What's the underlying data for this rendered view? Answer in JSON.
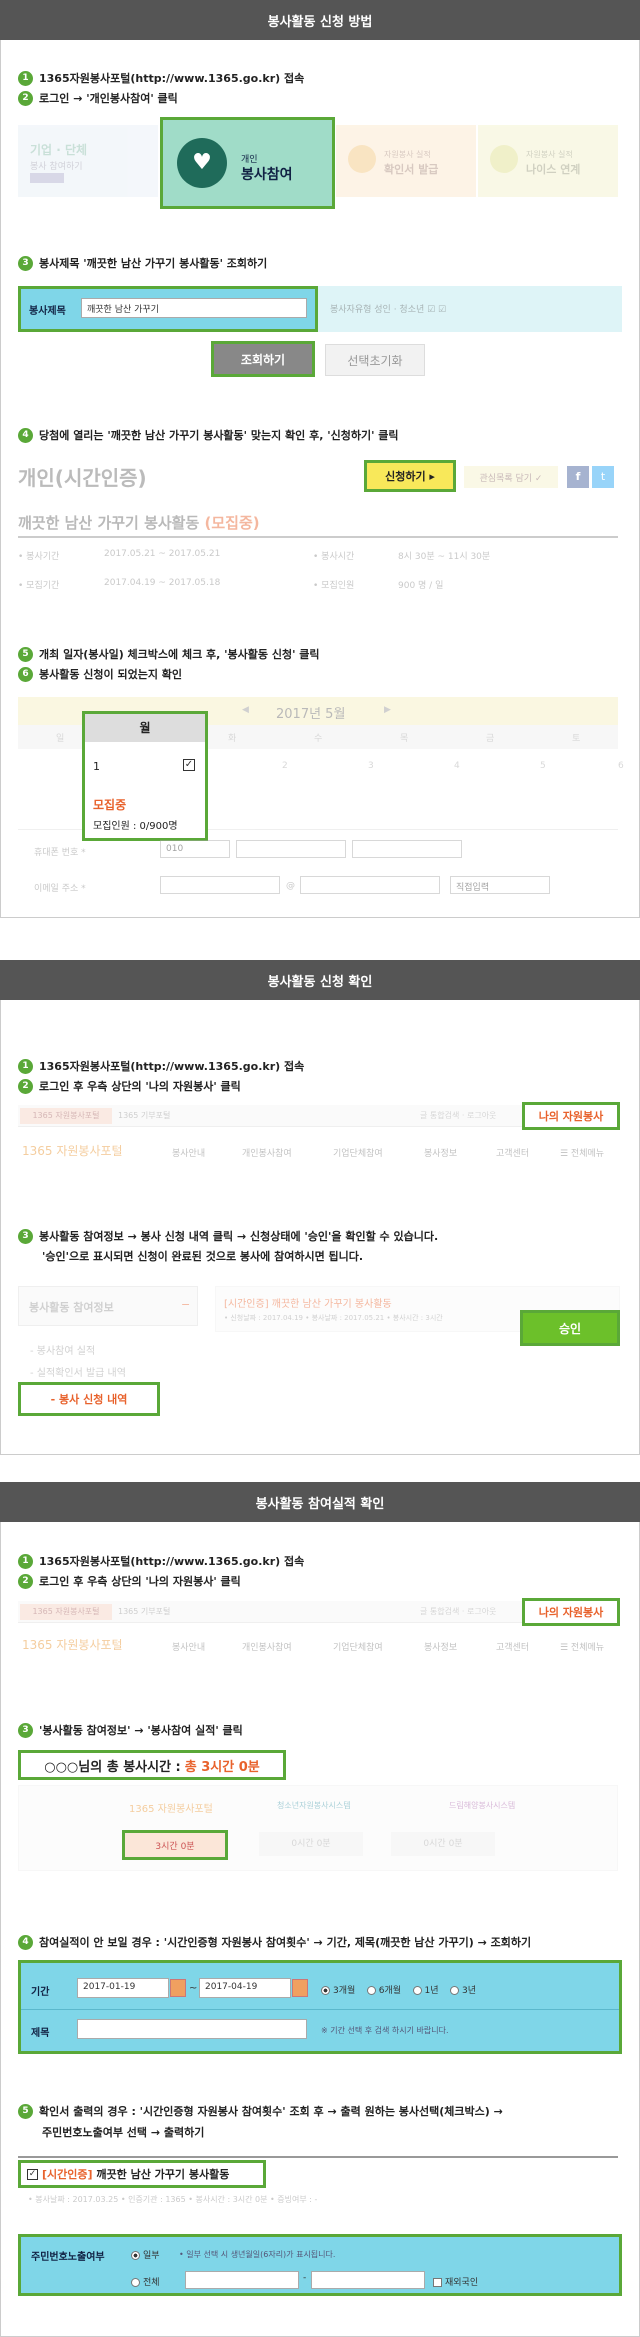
{
  "section1": {
    "title": "봉사활동 신청 방법",
    "step1": "1365자원봉사포털(http://www.1365.go.kr) 접속",
    "step2": "로그인 → '개인봉사참여' 클릭",
    "menu": {
      "group_label": "기업 · 단체",
      "group_sub": "봉사 참여하기",
      "personal_small": "개인",
      "personal_big": "봉사참여",
      "confirm_small": "자원봉사 실적",
      "confirm_big": "확인서 발급",
      "neis_small": "자원봉사 실적",
      "neis_big": "나이스 연계"
    },
    "step3": "봉사제목 '깨끗한 남산 가꾸기 봉사활동' 조회하기",
    "search_label": "봉사제목",
    "search_value": "깨끗한 남산 가꾸기",
    "search_type_label": "봉사자유형",
    "search_type_opts": "성인 · 청소년",
    "btn_search": "조회하기",
    "btn_reset": "선택초기화",
    "step4": "당첨에 열리는 '깨끗한 남산 가꾸기 봉사활동' 맞는지 확인 후, '신청하기' 클릭",
    "category": "개인(시간인증)",
    "btn_apply": "신청하기 ▸",
    "btn_interest": "관심목록 담기 ✓",
    "activity_title": "깨끗한 남산 가꾸기 봉사활동",
    "activity_status": "(모집중)",
    "info": {
      "l1": "봉사기간",
      "v1": "2017.05.21 ~ 2017.05.21",
      "l2": "봉사시간",
      "v2": "8시 30분 ~ 11시 30분",
      "l3": "모집기간",
      "v3": "2017.04.19 ~ 2017.05.18",
      "l4": "모집인원",
      "v4": "900 명 / 일"
    },
    "step5": "개최 일자(봉사일) 체크박스에 체크 후, '봉사활동 신청' 클릭",
    "step6": "봉사활동 신청이 되었는지 확인",
    "calendar": {
      "month": "2017년 5월",
      "days": [
        "일",
        "월",
        "화",
        "수",
        "목",
        "금",
        "토"
      ],
      "dates": [
        "1",
        "2",
        "3",
        "4",
        "5",
        "6"
      ],
      "mon_label": "월",
      "date_sel": "1",
      "recruiting": "모집중",
      "capacity": "모집인원 : 0/900명"
    },
    "form": {
      "phone": "휴대폰 번호 *",
      "phone_pre": "010",
      "email": "이메일 주소 *",
      "at": "@",
      "email_sel": "직접입력"
    }
  },
  "section2": {
    "title": "봉사활동 신청 확인",
    "step1": "1365자원봉사포털(http://www.1365.go.kr) 접속",
    "step2": "로그인 후 우측 상단의 '나의 자원봉사' 클릭",
    "topbar": {
      "left1": "1365 자원봉사포털",
      "left2": "1365 기부포털",
      "right": "나의 자원봉사",
      "extra": "글 통합검색 · 로그아웃"
    },
    "logo": "1365 자원봉사포털",
    "nav": [
      "봉사안내",
      "개인봉사참여",
      "기업단체참여",
      "봉사정보",
      "고객센터",
      "☰ 전체메뉴"
    ],
    "step3a": "봉사활동 참여정보 → 봉사 신청 내역 클릭 → 신청상태에 '승인'을 확인할 수 있습니다.",
    "step3b": "'승인'으로 표시되면 신청이 완료된 것으로 봉사에 참여하시면 됩니다.",
    "side_title": "봉사활동 참여정보",
    "side_minus": "−",
    "side_items": [
      "- 봉사참여 실적",
      "- 실적확인서 발급 내역"
    ],
    "side_active": "- 봉사 신청 내역",
    "entry_title": "[시간인증] 깨끗한 남산 가꾸기 봉사활동",
    "entry_meta": "• 신청날짜 : 2017.04.19  • 봉사날짜 : 2017.05.21  • 봉사시간 : 3시간",
    "approve": "승인"
  },
  "section3": {
    "title": "봉사활동 참여실적 확인",
    "step1": "1365자원봉사포털(http://www.1365.go.kr) 접속",
    "step2": "로그인 후 우측 상단의 '나의 자원봉사' 클릭",
    "step3": "'봉사활동 참여정보' → '봉사참여 실적' 클릭",
    "total_label": "○○○님의 총 봉사시간 :",
    "total_value": "총 3시간 0분",
    "portals": [
      "1365 자원봉사포털",
      "청소년자원봉사시스템",
      "드림해양봉사시스템"
    ],
    "portal_times": [
      "3시간 0분",
      "0시간 0분",
      "0시간 0분"
    ],
    "step4": "참여실적이 안 보일 경우 : '시간인증형 자원봉사 참여횟수' → 기간, 제목(깨끗한 남산 가꾸기) → 조회하기",
    "period_label": "기간",
    "date_from": "2017-01-19",
    "date_to": "2017-04-19",
    "periods": [
      "3개월",
      "6개월",
      "1년",
      "3년"
    ],
    "title_label": "제목",
    "title_note": "※ 기간 선택 후 검색 하시기 바랍니다.",
    "step5a": "확인서 출력의 경우 : '시간인증형 자원봉사 참여횟수' 조회 후 → 출력 원하는 봉사선택(체크박스) →",
    "step5b": "주민번호노출여부 선택 → 출력하기",
    "entry_title_tag": "[시간인증]",
    "entry_title": "깨끗한 남산 가꾸기 봉사활동",
    "entry_meta": "• 봉사날짜 : 2017.03.25  • 인증기관 : 1365  • 봉사시간 : 3시간 0분  • 증빙여부 : -",
    "id_label": "주민번호노출여부",
    "opt_part": "일부",
    "opt_part_note": "• 일부 선택 시 생년월일(6자리)가 표시됩니다.",
    "opt_all": "전체",
    "foreigner": "재외국인"
  },
  "colors": {
    "green": "#5aa838",
    "orange": "#e8622c",
    "teal": "#7fd6e8",
    "header": "#555555"
  }
}
